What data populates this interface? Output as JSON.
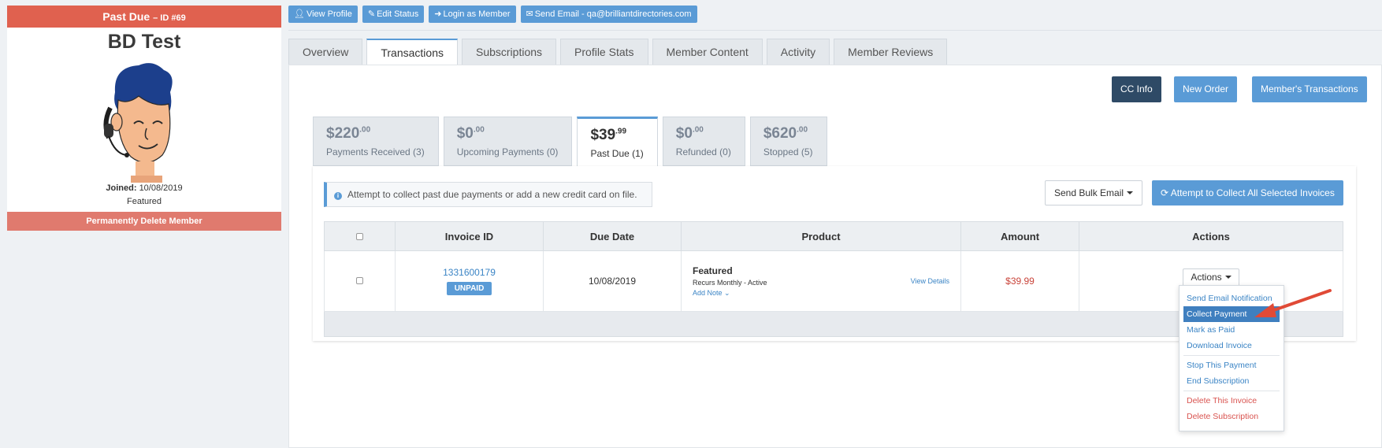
{
  "profile": {
    "status": "Past Due",
    "id_label": "– ID #69",
    "name": "BD Test",
    "joined_label": "Joined:",
    "joined_date": "10/08/2019",
    "membership": "Featured",
    "delete_label": "Permanently Delete Member"
  },
  "top_actions": [
    {
      "icon": "user-icon",
      "label": "View Profile"
    },
    {
      "icon": "pencil-icon",
      "label": "Edit Status"
    },
    {
      "icon": "login-icon",
      "label": "Login as Member"
    },
    {
      "icon": "envelope-icon",
      "label": "Send Email - qa@brilliantdirectories.com"
    }
  ],
  "tabs": [
    {
      "label": "Overview",
      "active": false
    },
    {
      "label": "Transactions",
      "active": true
    },
    {
      "label": "Subscriptions",
      "active": false
    },
    {
      "label": "Profile Stats",
      "active": false
    },
    {
      "label": "Member Content",
      "active": false
    },
    {
      "label": "Activity",
      "active": false
    },
    {
      "label": "Member Reviews",
      "active": false
    }
  ],
  "panel_buttons": {
    "cc_info": "CC Info",
    "new_order": "New Order",
    "member_transactions": "Member's Transactions"
  },
  "summary": [
    {
      "amount": "$220",
      "cents": ".00",
      "label": "Payments Received (3)",
      "active": false
    },
    {
      "amount": "$0",
      "cents": ".00",
      "label": "Upcoming Payments (0)",
      "active": false
    },
    {
      "amount": "$39",
      "cents": ".99",
      "label": "Past Due (1)",
      "active": true
    },
    {
      "amount": "$0",
      "cents": ".00",
      "label": "Refunded (0)",
      "active": false
    },
    {
      "amount": "$620",
      "cents": ".00",
      "label": "Stopped (5)",
      "active": false
    }
  ],
  "info_message": "Attempt to collect past due payments or add a new credit card on file.",
  "bulk_email_label": "Send Bulk Email",
  "collect_all_label": "Attempt to Collect All Selected Invoices",
  "table": {
    "headers": [
      "Invoice ID",
      "Due Date",
      "Product",
      "Amount",
      "Actions"
    ],
    "rows": [
      {
        "invoice_id": "1331600179",
        "status": "UNPAID",
        "due_date": "10/08/2019",
        "product": "Featured",
        "product_detail": "Recurs Monthly - Active",
        "add_note": "Add Note",
        "view_details": "View Details",
        "amount": "$39.99",
        "actions_label": "Actions"
      }
    ]
  },
  "dropdown": {
    "items": [
      {
        "label": "Send Email Notification",
        "type": "link"
      },
      {
        "label": "Collect Payment",
        "type": "active"
      },
      {
        "label": "Mark as Paid",
        "type": "link"
      },
      {
        "label": "Download Invoice",
        "type": "link"
      },
      {
        "label": "Stop This Payment",
        "type": "link",
        "sep_before": true
      },
      {
        "label": "End Subscription",
        "type": "link"
      },
      {
        "label": "Delete This Invoice",
        "type": "danger",
        "sep_before": true
      },
      {
        "label": "Delete Subscription",
        "type": "danger"
      }
    ]
  },
  "colors": {
    "past_due_red": "#e0614f",
    "primary_blue": "#5a9bd6",
    "dark_navy": "#2e4a66",
    "amount_red": "#c9443a",
    "arrow_red": "#e04a36"
  }
}
